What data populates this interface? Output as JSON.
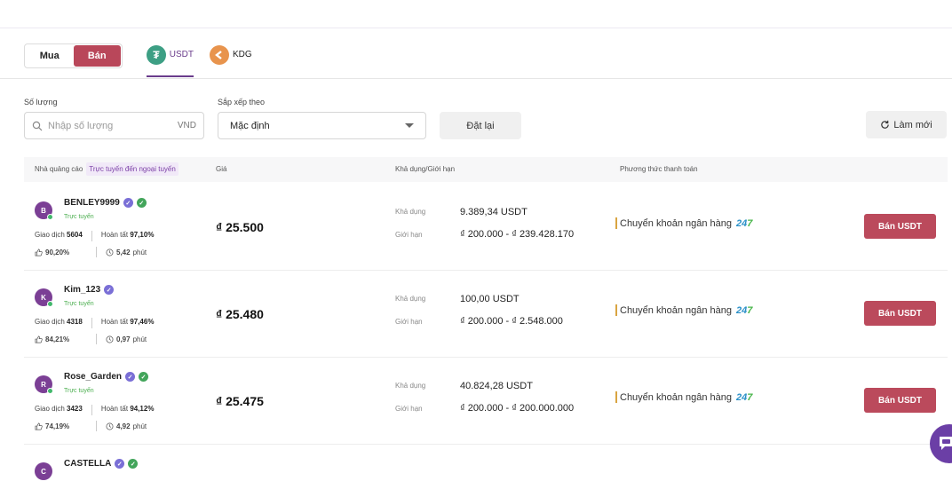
{
  "toggle": {
    "buy_label": "Mua",
    "sell_label": "Bán"
  },
  "coins": [
    {
      "label": "USDT",
      "icon": "tether-icon",
      "active": true
    },
    {
      "label": "KDG",
      "icon": "kdg-icon",
      "active": false
    }
  ],
  "filters": {
    "amount_label": "Số lượng",
    "amount_placeholder": "Nhập số lượng",
    "amount_unit": "VND",
    "sort_label": "Sắp xếp theo",
    "sort_value": "Mặc định",
    "reset_label": "Đặt lại",
    "refresh_label": "Làm mới"
  },
  "table": {
    "col_advertiser": "Nhà quảng cáo",
    "online_badge": "Trực tuyến đến ngoại tuyến",
    "col_price": "Giá",
    "col_available": "Khả dụng/Giới hạn",
    "col_payment": "Phương thức thanh toán",
    "rows": [
      {
        "initial": "B",
        "name": "BENLEY9999",
        "status": "Trực tuyến",
        "trades_label": "Giao dịch",
        "trades": "5604",
        "completion_label": "Hoàn tất",
        "completion": "97,10%",
        "likes": "90,20%",
        "time": "5,42",
        "time_unit": "phút",
        "price": "₫ 25.500",
        "available_label": "Khả dụng",
        "available": "9.389,34 USDT",
        "limit_label": "Giới hạn",
        "limit": "₫ 200.000 - ₫ 239.428.170",
        "payment": "Chuyển khoản ngân hàng",
        "payment_brand_a": "24",
        "payment_brand_b": "7",
        "action": "Bán USDT",
        "merchant": true
      },
      {
        "initial": "K",
        "name": "Kim_123",
        "status": "Trực tuyến",
        "trades_label": "Giao dịch",
        "trades": "4318",
        "completion_label": "Hoàn tất",
        "completion": "97,46%",
        "likes": "84,21%",
        "time": "0,97",
        "time_unit": "phút",
        "price": "₫ 25.480",
        "available_label": "Khả dụng",
        "available": "100,00 USDT",
        "limit_label": "Giới hạn",
        "limit": "₫ 200.000 - ₫ 2.548.000",
        "payment": "Chuyển khoản ngân hàng",
        "payment_brand_a": "24",
        "payment_brand_b": "7",
        "action": "Bán USDT",
        "merchant": false
      },
      {
        "initial": "R",
        "name": "Rose_Garden",
        "status": "Trực tuyến",
        "trades_label": "Giao dịch",
        "trades": "3423",
        "completion_label": "Hoàn tất",
        "completion": "94,12%",
        "likes": "74,19%",
        "time": "4,92",
        "time_unit": "phút",
        "price": "₫ 25.475",
        "available_label": "Khả dụng",
        "available": "40.824,28 USDT",
        "limit_label": "Giới hạn",
        "limit": "₫ 200.000 - ₫ 200.000.000",
        "payment": "Chuyển khoản ngân hàng",
        "payment_brand_a": "24",
        "payment_brand_b": "7",
        "action": "Bán USDT",
        "merchant": true
      },
      {
        "initial": "C",
        "name": "CASTELLA",
        "merchant": true
      }
    ]
  },
  "colors": {
    "accent": "#6a3c8b",
    "sell": "#bb4a5c",
    "online": "#4caf50"
  }
}
